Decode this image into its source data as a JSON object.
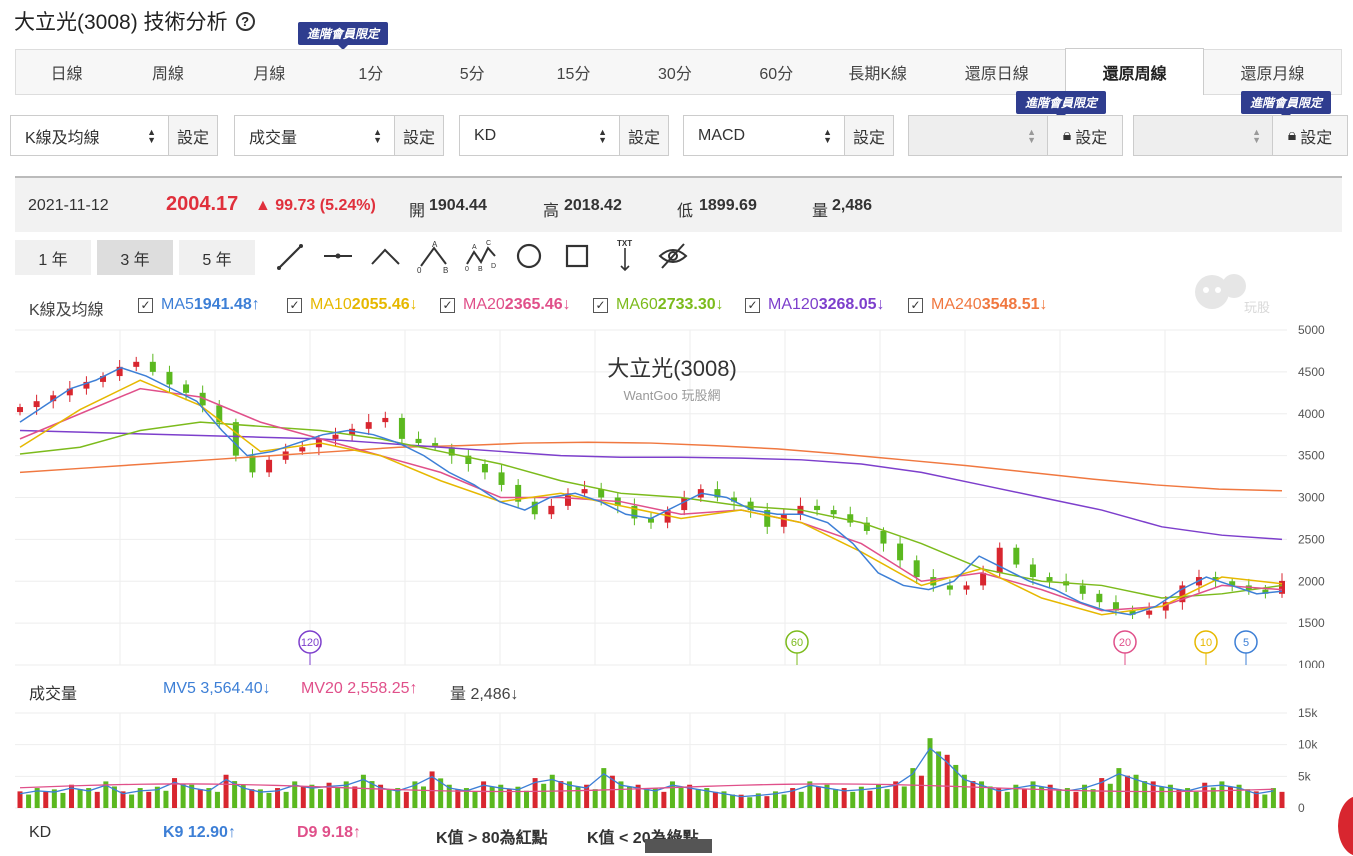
{
  "page": {
    "title": "大立光(3008) 技術分析",
    "help_icon": "?"
  },
  "badge": "進階會員限定",
  "tabs": [
    "日線",
    "周線",
    "月線",
    "1分",
    "5分",
    "15分",
    "30分",
    "60分",
    "長期K線",
    "還原日線",
    "還原周線",
    "還原月線"
  ],
  "active_tab": "還原周線",
  "selectors": [
    {
      "value": "K線及均線",
      "button": "設定"
    },
    {
      "value": "成交量",
      "button": "設定"
    },
    {
      "value": "KD",
      "button": "設定"
    },
    {
      "value": "MACD",
      "button": "設定"
    },
    {
      "value": "",
      "button": "設定",
      "locked": true
    },
    {
      "value": "",
      "button": "設定",
      "locked": true
    }
  ],
  "quote": {
    "date": "2021-11-12",
    "price": "2004.17",
    "change": "▲ 99.73 (5.24%)",
    "open_label": "開",
    "open": "1904.44",
    "high_label": "高",
    "high": "2018.42",
    "low_label": "低",
    "low": "1899.69",
    "vol_label": "量",
    "vol": "2,486"
  },
  "ranges": [
    "1 年",
    "3 年",
    "5 年"
  ],
  "active_range": "3 年",
  "tools": [
    "line-tool",
    "ray-tool",
    "wedge-tool",
    "abc-tool",
    "abcd-tool",
    "circle-tool",
    "rectangle-tool",
    "text-tool",
    "hide-tool"
  ],
  "kline": {
    "label": "K線及均線",
    "mas": [
      {
        "name": "MA5",
        "value": "1941.48",
        "arrow": "↑",
        "color": "#3d7fd6"
      },
      {
        "name": "MA10",
        "value": "2055.46",
        "arrow": "↓",
        "color": "#e6b800"
      },
      {
        "name": "MA20",
        "value": "2365.46",
        "arrow": "↓",
        "color": "#e0508a"
      },
      {
        "name": "MA60",
        "value": "2733.30",
        "arrow": "↓",
        "color": "#7cbb1c"
      },
      {
        "name": "MA120",
        "value": "3268.05",
        "arrow": "↓",
        "color": "#7d3fcc"
      },
      {
        "name": "MA240",
        "value": "3548.51",
        "arrow": "↓",
        "color": "#f07840"
      }
    ],
    "watermark_title": "大立光(3008)",
    "watermark_sub": "WantGoo 玩股網",
    "logo_text": "玩股網",
    "yticks": [
      "5000",
      "4500",
      "4000",
      "3500",
      "3000",
      "2500",
      "2000",
      "1500",
      "1000"
    ],
    "markers": [
      "120",
      "60",
      "20",
      "10",
      "5"
    ]
  },
  "volume": {
    "label": "成交量",
    "mv5": "MV5 3,564.40↓",
    "mv20": "MV20 2,558.25↑",
    "vol": "量 2,486↓",
    "yticks": [
      "15k",
      "10k",
      "5k",
      "0"
    ]
  },
  "kd": {
    "label": "KD",
    "k": "K9 12.90↑",
    "d": "D9 9.18↑",
    "note1": "K值 > 80為紅點",
    "note2": "K值 < 20為綠點"
  },
  "chart_data": {
    "type": "candlestick",
    "title": "大立光(3008)",
    "ylim": [
      1000,
      5000
    ],
    "close_approx": [
      4080,
      4150,
      4220,
      4300,
      4380,
      4450,
      4560,
      4620,
      4500,
      4350,
      4250,
      4100,
      3900,
      3500,
      3300,
      3450,
      3550,
      3600,
      3700,
      3750,
      3820,
      3900,
      3950,
      3700,
      3650,
      3600,
      3500,
      3400,
      3300,
      3150,
      2950,
      2800,
      2900,
      3050,
      3100,
      3000,
      2900,
      2750,
      2700,
      2850,
      3000,
      3100,
      3000,
      2950,
      2850,
      2650,
      2800,
      2900,
      2850,
      2800,
      2700,
      2600,
      2450,
      2250,
      2050,
      1950,
      1900,
      1950,
      2100,
      2400,
      2200,
      2050,
      2000,
      1950,
      1850,
      1750,
      1650,
      1600,
      1650,
      1750,
      1950,
      2050,
      2000,
      1950,
      1900,
      1850,
      2004
    ],
    "ma_series_approx": {
      "MA5": [
        3900,
        4100,
        4300,
        4400,
        4550,
        4450,
        4300,
        4150,
        3800,
        3500,
        3550,
        3650,
        3750,
        3800,
        3750,
        3650,
        3500,
        3300,
        3150,
        2950,
        2850,
        3000,
        3050,
        2950,
        2800,
        2750,
        2900,
        3050,
        3000,
        2850,
        2800,
        2800,
        2700,
        2450,
        2100,
        1950,
        1900,
        2000,
        2300,
        2150,
        2000,
        1900,
        1750,
        1650,
        1600,
        1700,
        1900,
        2050,
        1950,
        1850,
        1880
      ],
      "MA240": [
        3300,
        3350,
        3400,
        3450,
        3500,
        3550,
        3600,
        3620,
        3650,
        3660,
        3650,
        3620,
        3580,
        3520,
        3450,
        3380,
        3300,
        3220,
        3150,
        3100,
        3080
      ]
    },
    "volume_k_approx": [
      2.5,
      3,
      2.8,
      3.5,
      3,
      4,
      2.5,
      3,
      3.2,
      4.5,
      3.5,
      3,
      5,
      3.5,
      2.8,
      3,
      4,
      3.5,
      3.8,
      4,
      5,
      3.5,
      3,
      4,
      5.5,
      3.5,
      3,
      4,
      3.5,
      3.2,
      4.5,
      5,
      4,
      3.5,
      6,
      4,
      3.5,
      3,
      4,
      3.5,
      3,
      2.5,
      2,
      2.2,
      2.5,
      3,
      4,
      3.5,
      3,
      3.2,
      3.5,
      4,
      6,
      10.5,
      8,
      5,
      4,
      3,
      3.5,
      4,
      3.5,
      3,
      3.5,
      4.5,
      6,
      5,
      4,
      3.5,
      3,
      3.8,
      4,
      3.5,
      2.5,
      3
    ]
  }
}
